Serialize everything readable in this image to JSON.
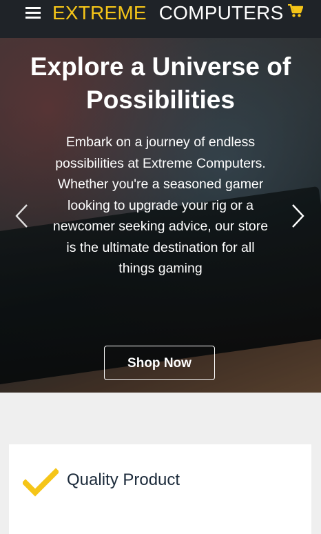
{
  "header": {
    "brand_part1": "EXTREME",
    "brand_part2": "COMPUTERS",
    "accent_color": "#f5c518",
    "menu_icon": "hamburger-menu-icon",
    "cart_icon": "shopping-cart-icon"
  },
  "hero": {
    "title": "Explore a Universe of Possibilities",
    "text": "Embark on a journey of endless possibilities at Extreme Computers. Whether you're a seasoned gamer looking to upgrade your rig or a newcomer seeking advice, our store is the ultimate destination for all things gaming",
    "cta_label": "Shop Now",
    "prev_icon": "chevron-left-icon",
    "next_icon": "chevron-right-icon"
  },
  "features": [
    {
      "title": "Quality Product",
      "icon": "checkmark-icon"
    }
  ]
}
